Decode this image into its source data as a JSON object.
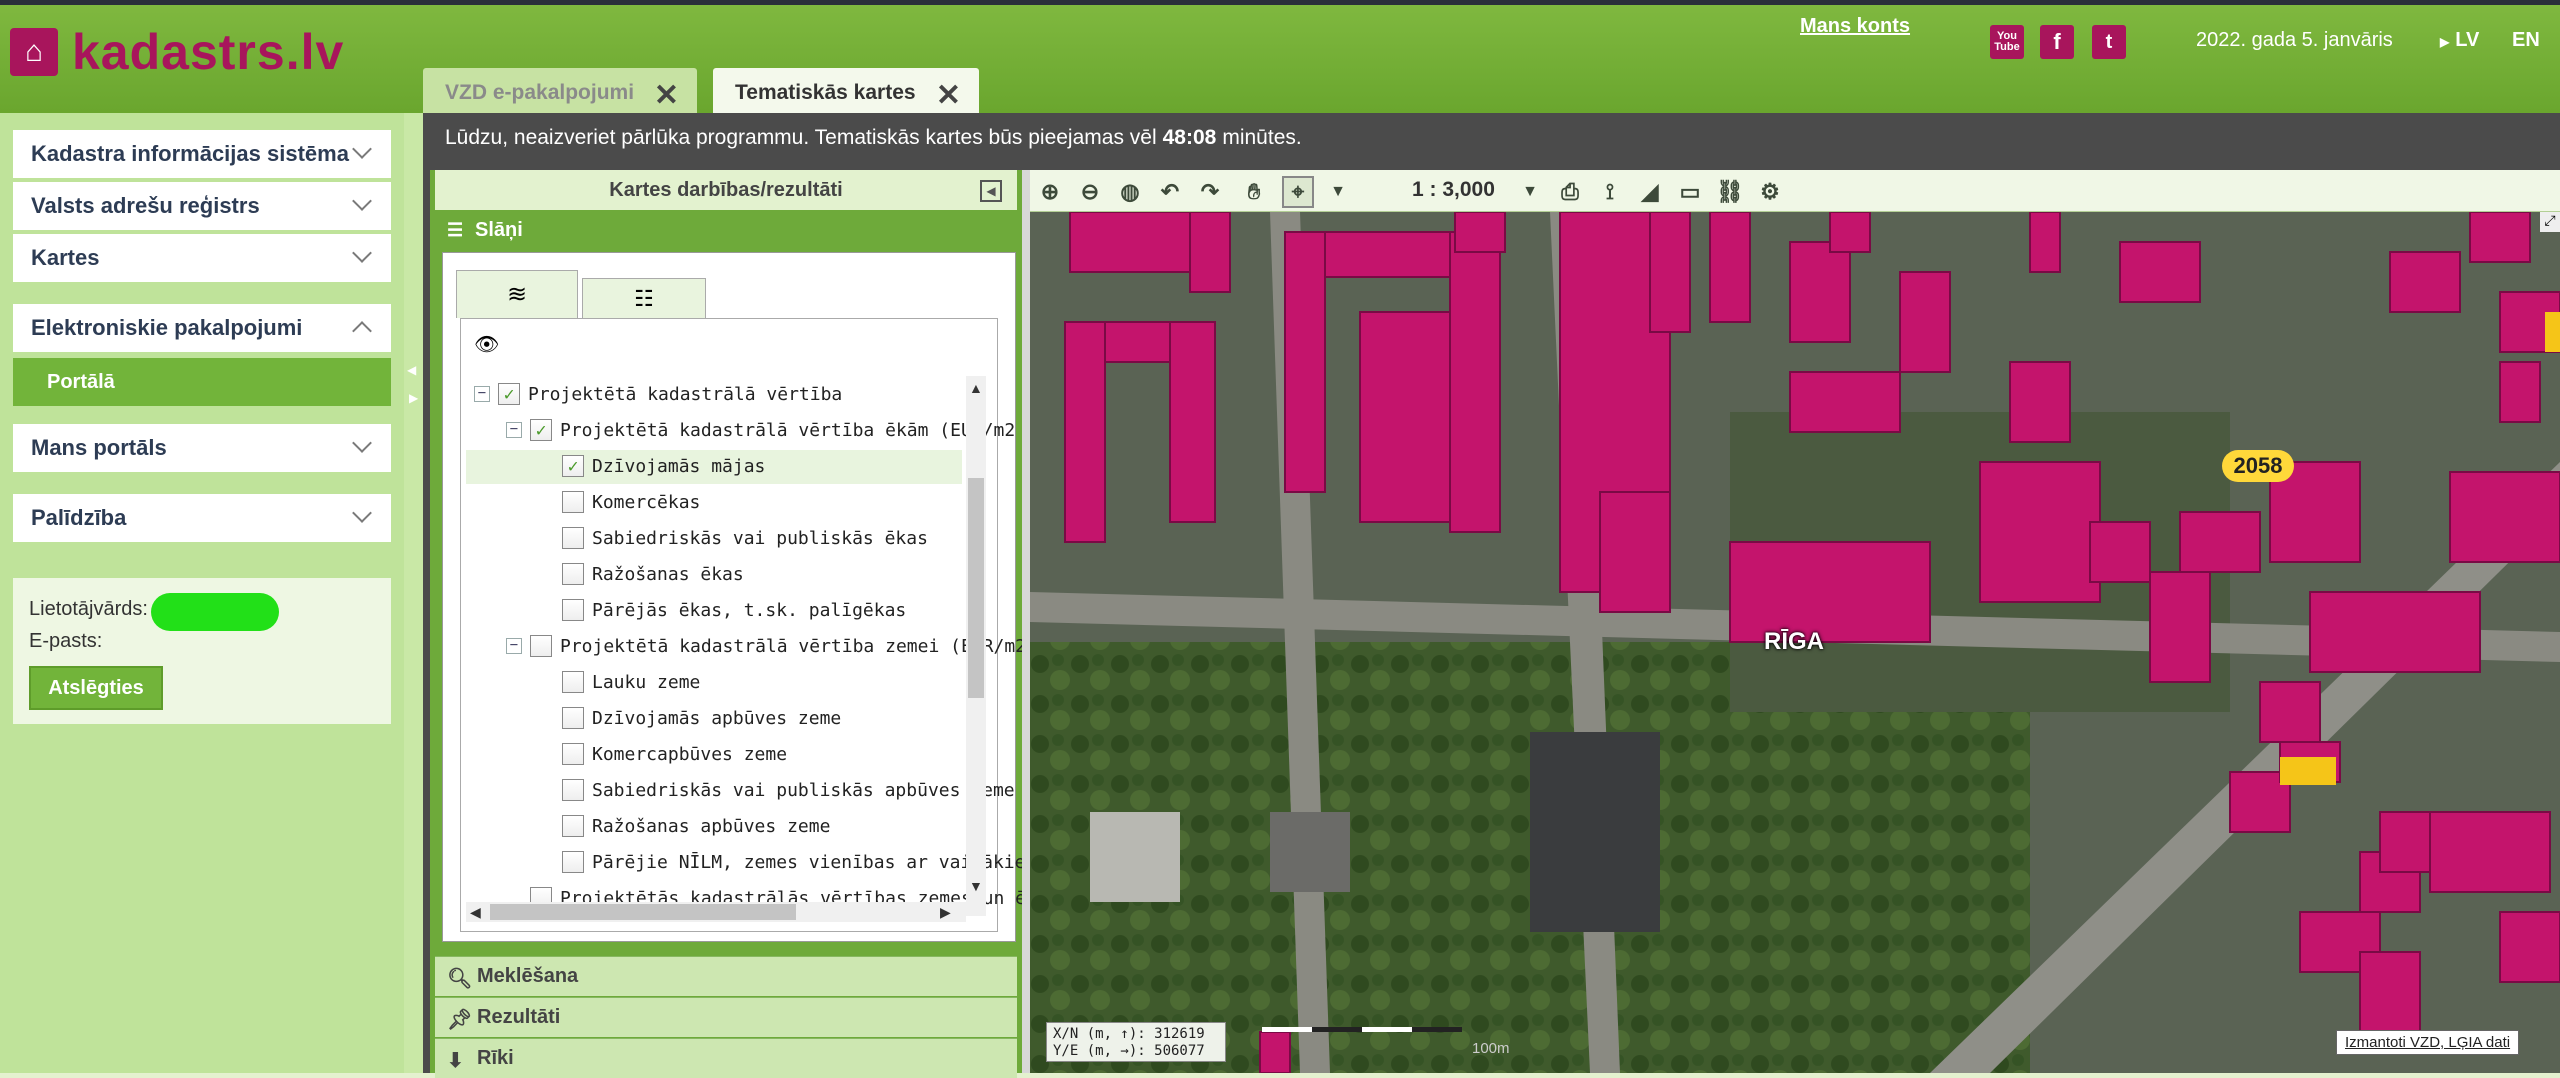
{
  "header": {
    "logo_text": "kadastrs.lv",
    "my_account": "Mans konts",
    "date": "2022. gada 5. janvāris",
    "lang_lv": "LV",
    "lang_en": "EN",
    "social": [
      "You Tube",
      "f",
      "t"
    ]
  },
  "tabs": [
    {
      "label": "VZD e-pakalpojumi",
      "active": false
    },
    {
      "label": "Tematiskās kartes",
      "active": true
    }
  ],
  "notice": {
    "pre": "Lūdzu, neaizveriet pārlūka programmu. Tematiskās kartes būs pieejamas vēl",
    "time": "48:08",
    "post": "minūtes."
  },
  "sidebar": {
    "items": [
      {
        "label": "Kadastra informācijas sistēma"
      },
      {
        "label": "Valsts adrešu reģistrs"
      },
      {
        "label": "Kartes"
      },
      {
        "label": "Elektroniskie pakalpojumi"
      },
      {
        "label": "Mans portāls"
      },
      {
        "label": "Palīdzība"
      }
    ],
    "sub_active": "Portālā",
    "user": {
      "username_label": "Lietotājvārds:",
      "email_label": "E-pasts:",
      "logout": "Atslēgties"
    }
  },
  "panel": {
    "title": "Kartes darbības/rezultāti",
    "layers": "Slāņi",
    "tree": [
      {
        "label": "Projektētā kadastrālā vērtība",
        "level": 0,
        "checked": true,
        "expander": "−"
      },
      {
        "label": "Projektētā kadastrālā vērtība ēkām (EUR/m2",
        "level": 1,
        "checked": true,
        "expander": "−"
      },
      {
        "label": "Dzīvojamās mājas",
        "level": 2,
        "checked": true
      },
      {
        "label": "Komercēkas",
        "level": 2,
        "checked": false
      },
      {
        "label": "Sabiedriskās vai publiskās ēkas",
        "level": 2,
        "checked": false
      },
      {
        "label": "Ražošanas ēkas",
        "level": 2,
        "checked": false
      },
      {
        "label": "Pārējās ēkas, t.sk. palīgēkas",
        "level": 2,
        "checked": false
      },
      {
        "label": "Projektētā kadastrālā vērtība zemei (EUR/m2",
        "level": 1,
        "checked": false,
        "expander": "−"
      },
      {
        "label": "Lauku zeme",
        "level": 2,
        "checked": false
      },
      {
        "label": "Dzīvojamās apbūves zeme",
        "level": 2,
        "checked": false
      },
      {
        "label": "Komercapbūves zeme",
        "level": 2,
        "checked": false
      },
      {
        "label": "Sabiedriskās vai publiskās apbūves zeme",
        "level": 2,
        "checked": false
      },
      {
        "label": "Ražošanas apbūves zeme",
        "level": 2,
        "checked": false
      },
      {
        "label": "Pārējie NĪLM, zemes vienības ar vairākiem",
        "level": 2,
        "checked": false
      },
      {
        "label": "Projektētās kadastrālās vērtības zemes un ēk",
        "level": 1,
        "checked": false
      }
    ],
    "sections": [
      "Meklēšana",
      "Rezultāti",
      "Rīki"
    ]
  },
  "map": {
    "scale": "1 : 3,000",
    "coords_x": "X/N (m, ↑): 312619",
    "coords_y": "Y/E (m, →): 506077",
    "attribution": "Izmantoti VZD, LĢIA dati",
    "city_label": "RĪGA",
    "badge": "2058",
    "scalebar_label": "100m"
  },
  "colors": {
    "header_green": "#7fb83f",
    "brand": "#a8155c",
    "building": "#c4146c"
  }
}
